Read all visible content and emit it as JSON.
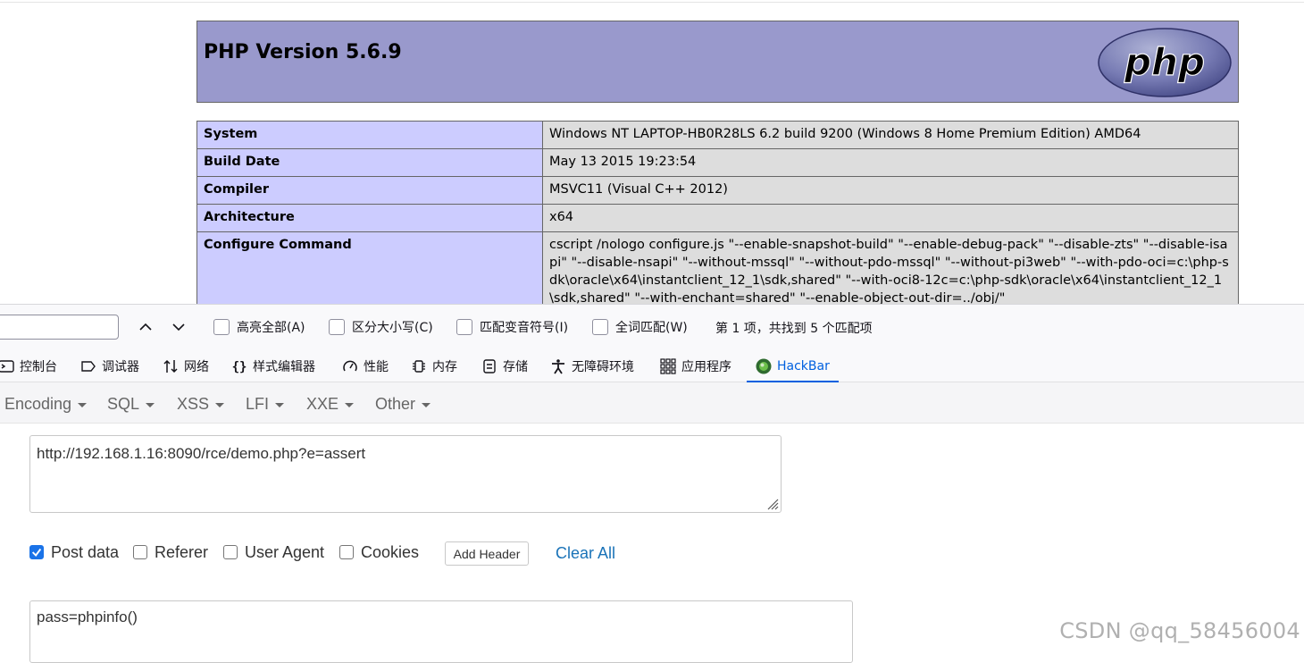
{
  "phpinfo": {
    "title": "PHP Version 5.6.9",
    "logo_text": "php",
    "rows": [
      {
        "key": "System",
        "value": "Windows NT LAPTOP-HB0R28LS 6.2 build 9200 (Windows 8 Home Premium Edition) AMD64"
      },
      {
        "key": "Build Date",
        "value": "May 13 2015 19:23:54"
      },
      {
        "key": "Compiler",
        "value": "MSVC11 (Visual C++ 2012)"
      },
      {
        "key": "Architecture",
        "value": "x64"
      },
      {
        "key": "Configure Command",
        "value": "cscript /nologo configure.js \"--enable-snapshot-build\" \"--enable-debug-pack\" \"--disable-zts\" \"--disable-isapi\" \"--disable-nsapi\" \"--without-mssql\" \"--without-pdo-mssql\" \"--without-pi3web\" \"--with-pdo-oci=c:\\php-sdk\\oracle\\x64\\instantclient_12_1\\sdk,shared\" \"--with-oci8-12c=c:\\php-sdk\\oracle\\x64\\instantclient_12_1\\sdk,shared\" \"--with-enchant=shared\" \"--enable-object-out-dir=../obj/\""
      }
    ]
  },
  "findbar": {
    "options": [
      {
        "label": "高亮全部(A)"
      },
      {
        "label": "区分大小写(C)"
      },
      {
        "label": "匹配变音符号(I)"
      },
      {
        "label": "全词匹配(W)"
      }
    ],
    "status": "第 1 项，共找到 5 个匹配项"
  },
  "devtools": {
    "tabs": [
      {
        "label": "控制台",
        "icon": "console-icon"
      },
      {
        "label": "调试器",
        "icon": "debugger-icon"
      },
      {
        "label": "网络",
        "icon": "network-icon"
      },
      {
        "label": "样式编辑器",
        "icon": "style-editor-icon"
      },
      {
        "label": "性能",
        "icon": "performance-icon"
      },
      {
        "label": "内存",
        "icon": "memory-icon"
      },
      {
        "label": "存储",
        "icon": "storage-icon"
      },
      {
        "label": "无障碍环境",
        "icon": "accessibility-icon"
      },
      {
        "label": "应用程序",
        "icon": "application-icon"
      },
      {
        "label": "HackBar",
        "icon": "hackbar-icon",
        "active": true
      }
    ]
  },
  "hackbar": {
    "menus": [
      "Encoding",
      "SQL",
      "XSS",
      "LFI",
      "XXE",
      "Other"
    ],
    "url": "http://192.168.1.16:8090/rce/demo.php?e=assert",
    "options": [
      {
        "label": "Post data",
        "checked": true
      },
      {
        "label": "Referer",
        "checked": false
      },
      {
        "label": "User Agent",
        "checked": false
      },
      {
        "label": "Cookies",
        "checked": false
      }
    ],
    "add_header_label": "Add Header",
    "clear_all_label": "Clear All",
    "post_body": "pass=phpinfo()",
    "accent_color": "#1a73e8"
  },
  "watermark": "CSDN @qq_58456004"
}
